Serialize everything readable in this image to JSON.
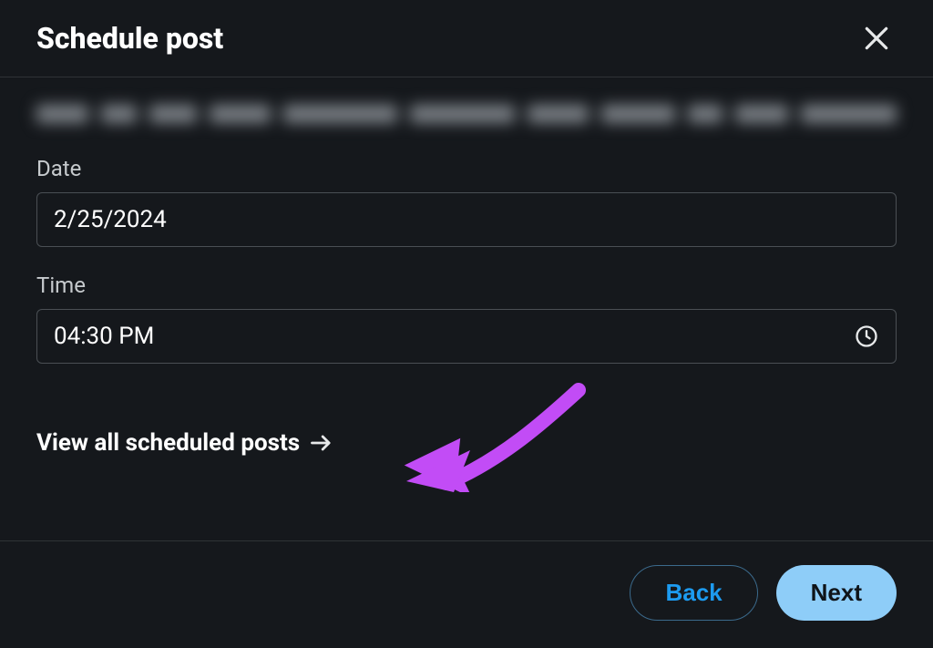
{
  "header": {
    "title": "Schedule post"
  },
  "fields": {
    "date_label": "Date",
    "date_value": "2/25/2024",
    "time_label": "Time",
    "time_value": "04:30 PM"
  },
  "links": {
    "view_all": "View all scheduled posts"
  },
  "footer": {
    "back": "Back",
    "next": "Next"
  }
}
